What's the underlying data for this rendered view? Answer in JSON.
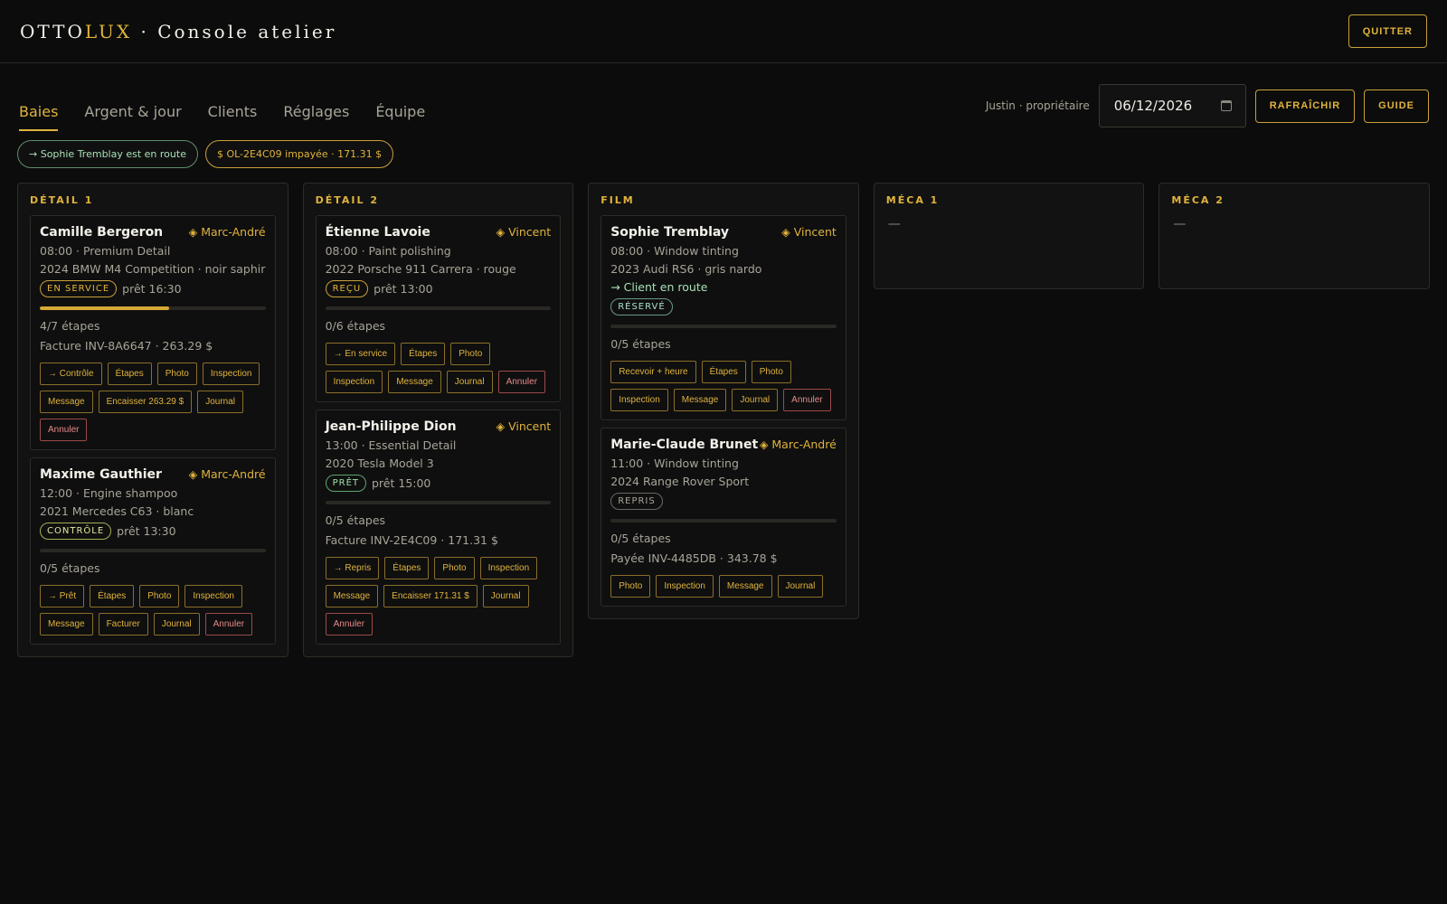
{
  "header": {
    "brand_part1": "OTTO",
    "brand_part2": "LUX",
    "brand_suffix": " · Console atelier",
    "quit_label": "QUITTER"
  },
  "nav": {
    "tabs": [
      "Baies",
      "Argent & jour",
      "Clients",
      "Réglages",
      "Équipe"
    ],
    "active_tab": "Baies",
    "user": "Justin · propriétaire",
    "date_value": "06/12/2026",
    "refresh_label": "RAFRAÎCHIR",
    "guide_label": "GUIDE"
  },
  "alerts": [
    "→ Sophie Tremblay est en route",
    "$ OL-2E4C09 impayée · 171.31 $"
  ],
  "colors": {
    "accent": "#e0b33c",
    "ok": "#a8e0b4",
    "danger": "#e88a8a",
    "background": "#0c0c0c"
  },
  "columns": [
    {
      "title": "DÉTAIL 1",
      "cards": [
        {
          "name": "Camille Bergeron",
          "tech": "◈ Marc-André",
          "service": "08:00 · Premium Detail",
          "vehicle": "2024 BMW M4 Competition · noir saphir",
          "status": "EN SERVICE",
          "status_kind": "service",
          "ready": "prêt 16:30",
          "progress": 0.571,
          "steps": "4/7 étapes",
          "invoice": "Facture INV-8A6647 · 263.29 $",
          "actions": [
            "→ Contrôle",
            "Étapes",
            "Photo",
            "Inspection",
            "Message",
            "Encaisser 263.29 $",
            "Journal"
          ],
          "danger_action": "Annuler"
        },
        {
          "name": "Maxime Gauthier",
          "tech": "◈ Marc-André",
          "service": "12:00 · Engine shampoo",
          "vehicle": "2021 Mercedes C63 · blanc",
          "status": "CONTRÔLE",
          "status_kind": "controle",
          "ready": "prêt 13:30",
          "progress": 0,
          "steps": "0/5 étapes",
          "actions": [
            "→ Prêt",
            "Étapes",
            "Photo",
            "Inspection",
            "Message",
            "Facturer",
            "Journal"
          ],
          "danger_action": "Annuler"
        }
      ]
    },
    {
      "title": "DÉTAIL 2",
      "cards": [
        {
          "name": "Étienne Lavoie",
          "tech": "◈ Vincent",
          "service": "08:00 · Paint polishing",
          "vehicle": "2022 Porsche 911 Carrera · rouge",
          "status": "REÇU",
          "status_kind": "recu",
          "ready": "prêt 13:00",
          "progress": 0,
          "steps": "0/6 étapes",
          "actions": [
            "→ En service",
            "Étapes",
            "Photo",
            "Inspection",
            "Message",
            "Journal"
          ],
          "danger_action": "Annuler"
        },
        {
          "name": "Jean-Philippe Dion",
          "tech": "◈ Vincent",
          "service": "13:00 · Essential Detail",
          "vehicle": "2020 Tesla Model 3",
          "status": "PRÊT",
          "status_kind": "pret",
          "ready": "prêt 15:00",
          "progress": 0,
          "steps": "0/5 étapes",
          "invoice": "Facture INV-2E4C09 · 171.31 $",
          "actions": [
            "→ Repris",
            "Étapes",
            "Photo",
            "Inspection",
            "Message",
            "Encaisser 171.31 $",
            "Journal"
          ],
          "danger_action": "Annuler"
        }
      ]
    },
    {
      "title": "FILM",
      "cards": [
        {
          "name": "Sophie Tremblay",
          "tech": "◈ Vincent",
          "service": "08:00 · Window tinting",
          "vehicle": "2023 Audi RS6 · gris nardo",
          "note": "→ Client en route",
          "status": "RÉSERVÉ",
          "status_kind": "reserve",
          "progress": 0,
          "steps": "0/5 étapes",
          "actions": [
            "Recevoir + heure",
            "Étapes",
            "Photo",
            "Inspection",
            "Message",
            "Journal"
          ],
          "danger_action": "Annuler"
        },
        {
          "name": "Marie-Claude Brunet",
          "tech": "◈ Marc-André",
          "service": "11:00 · Window tinting",
          "vehicle": "2024 Range Rover Sport",
          "status": "REPRIS",
          "status_kind": "repris",
          "progress": 0,
          "steps": "0/5 étapes",
          "invoice": "Payée INV-4485DB · 343.78 $",
          "actions": [
            "Photo",
            "Inspection",
            "Message",
            "Journal"
          ]
        }
      ]
    },
    {
      "title": "MÉCA 1",
      "cards": [],
      "empty": "—"
    },
    {
      "title": "MÉCA 2",
      "cards": [],
      "empty": "—"
    }
  ]
}
